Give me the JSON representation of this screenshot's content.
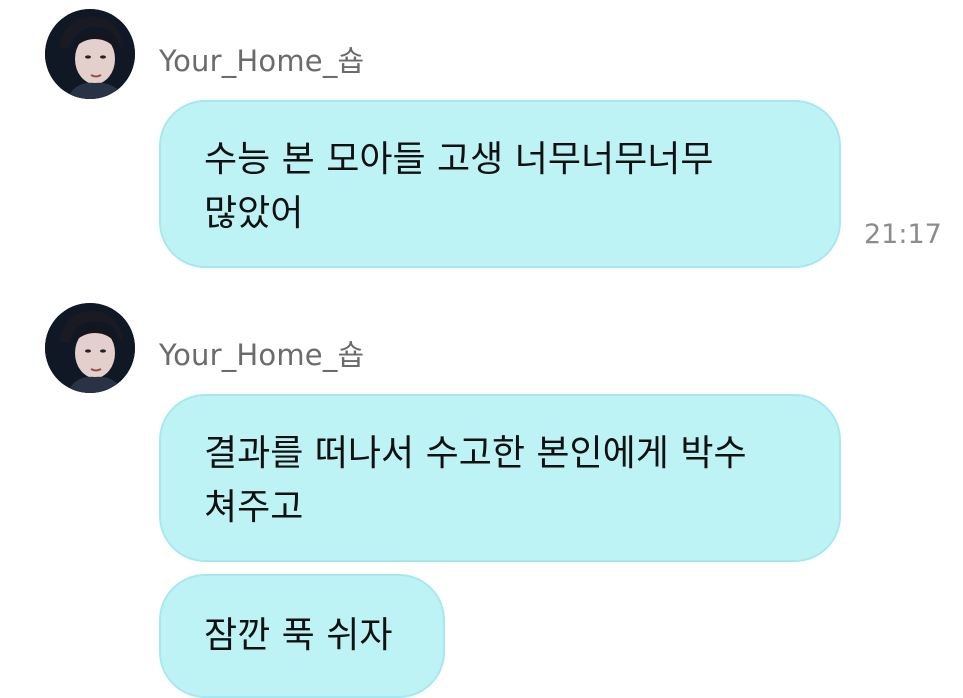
{
  "colors": {
    "bubble_bg": "#bef3f6",
    "bubble_border": "#a6e8ee",
    "sender_name": "#6b6b6b",
    "timestamp": "#8c8c8c",
    "page_bg": "#ffffff"
  },
  "messages": [
    {
      "sender": "Your_Home_숍",
      "avatar_icon": "profile-photo-icon",
      "bubbles": [
        {
          "lines": [
            "수능 본 모아들 고생 너무너무너무",
            "많았어"
          ],
          "time": "21:17"
        }
      ]
    },
    {
      "sender": "Your_Home_숍",
      "avatar_icon": "profile-photo-icon",
      "bubbles": [
        {
          "lines": [
            "결과를 떠나서 수고한 본인에게 박수",
            "쳐주고"
          ]
        },
        {
          "lines": [
            "잠깐 푹 쉬자"
          ]
        }
      ]
    }
  ]
}
